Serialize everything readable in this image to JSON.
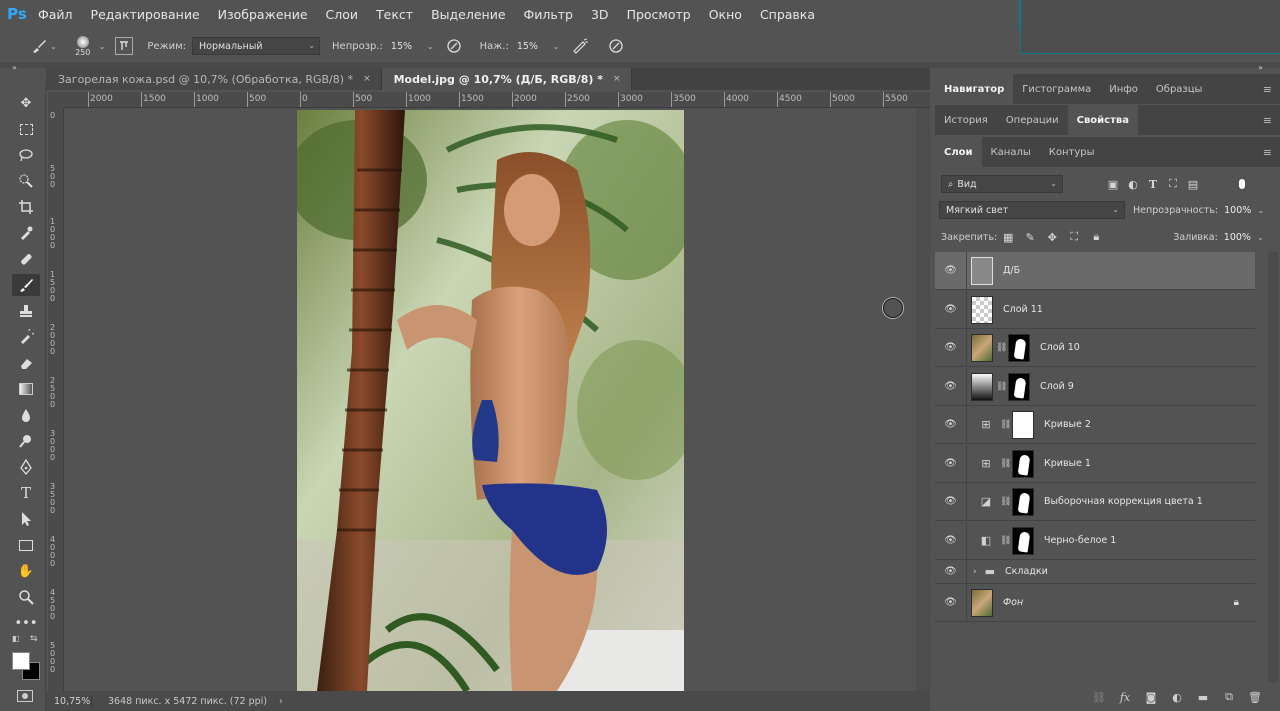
{
  "menubar": {
    "logo": "Ps",
    "items": [
      "Файл",
      "Редактирование",
      "Изображение",
      "Слои",
      "Текст",
      "Выделение",
      "Фильтр",
      "3D",
      "Просмотр",
      "Окно",
      "Справка"
    ]
  },
  "options": {
    "brush_size": "250",
    "mode_label": "Режим:",
    "mode_value": "Нормальный",
    "opacity_label": "Непрозр.:",
    "opacity_value": "15%",
    "flow_label": "Наж.:",
    "flow_value": "15%"
  },
  "collapse_glyph": "»",
  "tabs": [
    {
      "label": "Загорелая кожа.psd @ 10,7% (Обработка, RGB/8) *",
      "close": "×"
    },
    {
      "label": "Model.jpg @ 10,7% (Д/Б, RGB/8) *",
      "close": "×"
    }
  ],
  "ruler": {
    "h_labels": [
      "2000",
      "1500",
      "1000",
      "500",
      "0",
      "500",
      "1000",
      "1500",
      "2000",
      "2500",
      "3000",
      "3500",
      "4000",
      "4500",
      "5000",
      "5500"
    ],
    "v_labels": [
      "0",
      "5 0 0",
      "1 0 0 0",
      "1 5 0 0",
      "2 0 0 0",
      "2 5 0 0",
      "3 0 0 0",
      "3 5 0 0",
      "4 0 0 0",
      "4 5 0 0",
      "5 0 0 0"
    ]
  },
  "status": {
    "zoom": "10,75%",
    "doc_info": "3648 пикс. x 5472 пикс. (72 ppi)",
    "more": "›"
  },
  "panels": {
    "group1_tabs": [
      "Навигатор",
      "Гистограмма",
      "Инфо",
      "Образцы"
    ],
    "group2_tabs": [
      "История",
      "Операции",
      "Свойства"
    ],
    "group3_tabs": [
      "Слои",
      "Каналы",
      "Контуры"
    ],
    "menu_glyph": "≡"
  },
  "layers_panel": {
    "filter_value": "Вид",
    "blend_mode": "Мягкий свет",
    "opacity_label": "Непрозрачность:",
    "opacity_value": "100%",
    "lock_label": "Закрепить:",
    "fill_label": "Заливка:",
    "fill_value": "100%",
    "layers": [
      {
        "name": "Д/Б",
        "active": true
      },
      {
        "name": "Слой 11"
      },
      {
        "name": "Слой 10"
      },
      {
        "name": "Слой 9"
      },
      {
        "name": "Кривые 2"
      },
      {
        "name": "Кривые 1"
      },
      {
        "name": "Выборочная коррекция цвета 1"
      },
      {
        "name": "Черно-белое 1"
      },
      {
        "name": "Складки"
      },
      {
        "name": "Фон"
      }
    ]
  },
  "colors": {
    "accent": "#31a8ff",
    "panel_bg": "#535353",
    "active_layer": "#6a6a6a"
  }
}
